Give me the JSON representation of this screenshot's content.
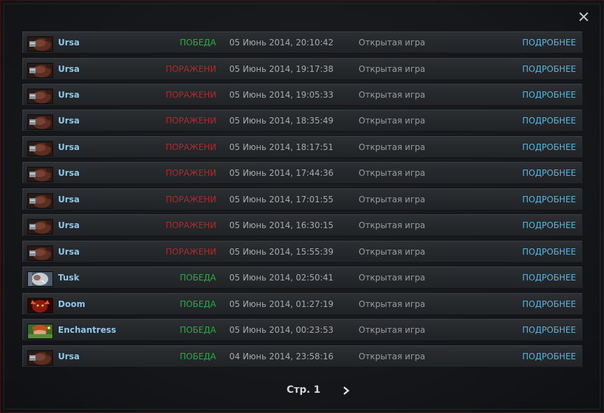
{
  "dialog": {
    "close_icon": "close-icon",
    "accent_border": "#3a1414"
  },
  "colors": {
    "hero_name": "#8fc8e8",
    "win": "#2fa84a",
    "loss": "#b12a29",
    "details_link": "#5fb4dc"
  },
  "matches": [
    {
      "hero": "Ursa",
      "portrait": "ursa",
      "result": "ПОБЕДА",
      "outcome": "win",
      "date": "05 Июнь 2014, 20:10:42",
      "mode": "Открытая игра",
      "details": "ПОДРОБНЕЕ"
    },
    {
      "hero": "Ursa",
      "portrait": "ursa",
      "result": "ПОРАЖЕНИ",
      "outcome": "loss",
      "date": "05 Июнь 2014, 19:17:38",
      "mode": "Открытая игра",
      "details": "ПОДРОБНЕЕ"
    },
    {
      "hero": "Ursa",
      "portrait": "ursa",
      "result": "ПОРАЖЕНИ",
      "outcome": "loss",
      "date": "05 Июнь 2014, 19:05:33",
      "mode": "Открытая игра",
      "details": "ПОДРОБНЕЕ"
    },
    {
      "hero": "Ursa",
      "portrait": "ursa",
      "result": "ПОРАЖЕНИ",
      "outcome": "loss",
      "date": "05 Июнь 2014, 18:35:49",
      "mode": "Открытая игра",
      "details": "ПОДРОБНЕЕ"
    },
    {
      "hero": "Ursa",
      "portrait": "ursa",
      "result": "ПОРАЖЕНИ",
      "outcome": "loss",
      "date": "05 Июнь 2014, 18:17:51",
      "mode": "Открытая игра",
      "details": "ПОДРОБНЕЕ"
    },
    {
      "hero": "Ursa",
      "portrait": "ursa",
      "result": "ПОРАЖЕНИ",
      "outcome": "loss",
      "date": "05 Июнь 2014, 17:44:36",
      "mode": "Открытая игра",
      "details": "ПОДРОБНЕЕ"
    },
    {
      "hero": "Ursa",
      "portrait": "ursa",
      "result": "ПОРАЖЕНИ",
      "outcome": "loss",
      "date": "05 Июнь 2014, 17:01:55",
      "mode": "Открытая игра",
      "details": "ПОДРОБНЕЕ"
    },
    {
      "hero": "Ursa",
      "portrait": "ursa",
      "result": "ПОРАЖЕНИ",
      "outcome": "loss",
      "date": "05 Июнь 2014, 16:30:15",
      "mode": "Открытая игра",
      "details": "ПОДРОБНЕЕ"
    },
    {
      "hero": "Ursa",
      "portrait": "ursa",
      "result": "ПОРАЖЕНИ",
      "outcome": "loss",
      "date": "05 Июнь 2014, 15:55:39",
      "mode": "Открытая игра",
      "details": "ПОДРОБНЕЕ"
    },
    {
      "hero": "Tusk",
      "portrait": "tusk",
      "result": "ПОБЕДА",
      "outcome": "win",
      "date": "05 Июнь 2014, 02:50:41",
      "mode": "Открытая игра",
      "details": "ПОДРОБНЕЕ"
    },
    {
      "hero": "Doom",
      "portrait": "doom",
      "result": "ПОБЕДА",
      "outcome": "win",
      "date": "05 Июнь 2014, 01:27:19",
      "mode": "Открытая игра",
      "details": "ПОДРОБНЕЕ"
    },
    {
      "hero": "Enchantress",
      "portrait": "enchantress",
      "result": "ПОБЕДА",
      "outcome": "win",
      "date": "05 Июнь 2014, 00:23:53",
      "mode": "Открытая игра",
      "details": "ПОДРОБНЕЕ"
    },
    {
      "hero": "Ursa",
      "portrait": "ursa",
      "result": "ПОБЕДА",
      "outcome": "win",
      "date": "04 Июнь 2014, 23:58:16",
      "mode": "Открытая игра",
      "details": "ПОДРОБНЕЕ"
    }
  ],
  "pagination": {
    "label": "Стр. 1",
    "next_icon": "chevron-right-icon"
  }
}
